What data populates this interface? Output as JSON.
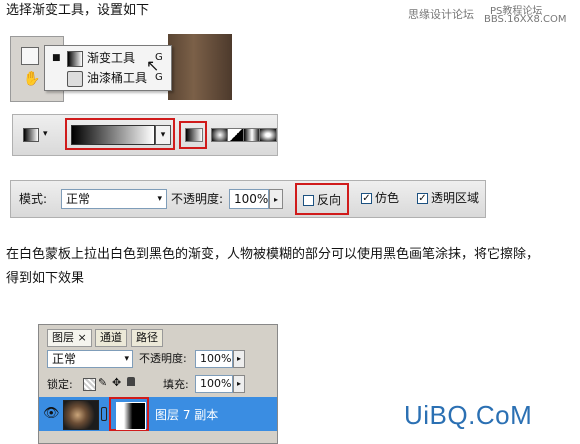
{
  "intro": "选择渐变工具，设置如下",
  "watermark": {
    "line1": "思缘设计论坛",
    "line2": "PS教程论坛",
    "line3": "BBS.16XX8.COM"
  },
  "menu": {
    "items": [
      {
        "label": "渐变工具",
        "key": "G",
        "icon": "gradient-tool-icon",
        "selected": true
      },
      {
        "label": "油漆桶工具",
        "key": "G",
        "icon": "paint-bucket-icon",
        "selected": false
      }
    ]
  },
  "gradient_bar": {
    "gradient_icon": "gradient-preview-icon",
    "styles": [
      "linear-gradient-icon",
      "radial-gradient-icon",
      "angle-gradient-icon",
      "reflected-gradient-icon",
      "diamond-gradient-icon"
    ]
  },
  "options_bar": {
    "mode_label": "模式:",
    "mode_value": "正常",
    "opacity_label": "不透明度:",
    "opacity_value": "100%",
    "reverse_label": "反向",
    "dither_label": "仿色",
    "transparency_label": "透明区域",
    "reverse_checked": false,
    "dither_checked": true,
    "transparency_checked": true
  },
  "description_line1": "在白色蒙板上拉出白色到黑色的渐变，人物被模糊的部分可以使用黑色画笔涂抹，将它擦除，",
  "description_line2": "得到如下效果",
  "layers_panel": {
    "tabs": [
      "图层",
      "通道",
      "路径"
    ],
    "close_symbol": "×",
    "blend_mode": "正常",
    "opacity_label": "不透明度:",
    "opacity_value": "100%",
    "lock_label": "锁定:",
    "fill_label": "填充:",
    "fill_value": "100%",
    "layer_name": "图层 7 副本"
  },
  "logo": "UiBQ.CoM"
}
